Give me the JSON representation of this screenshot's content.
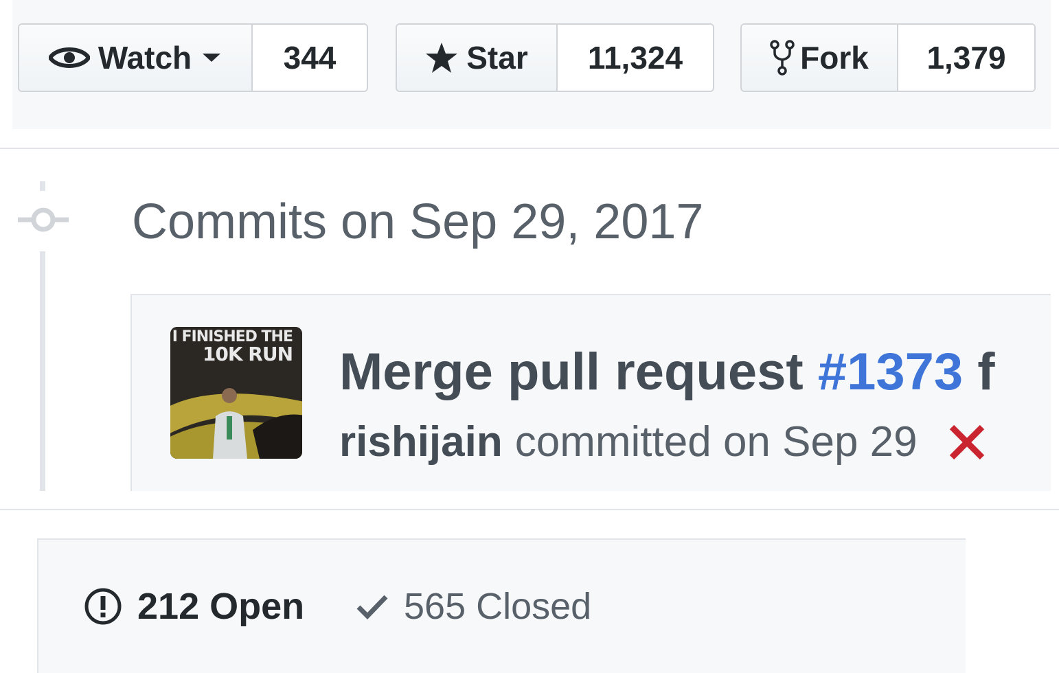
{
  "social": {
    "watch": {
      "label": "Watch",
      "count": "344"
    },
    "star": {
      "label": "Star",
      "count": "11,324"
    },
    "fork": {
      "label": "Fork",
      "count": "1,379"
    }
  },
  "commits": {
    "heading": "Commits on Sep 29, 2017",
    "items": [
      {
        "avatar_text_line1": "I FINISHED THE",
        "avatar_text_line2": "10K RUN",
        "title_prefix": "Merge pull request",
        "pr_number": "#1373",
        "title_suffix": "f",
        "author": "rishijain",
        "meta": "committed on Sep 29",
        "status": "failure"
      }
    ]
  },
  "issues": {
    "open_label": "212 Open",
    "closed_label": "565 Closed"
  },
  "colors": {
    "link": "#3f75d8",
    "failure": "#cb2431",
    "text": "#24292e",
    "muted": "#586069"
  }
}
